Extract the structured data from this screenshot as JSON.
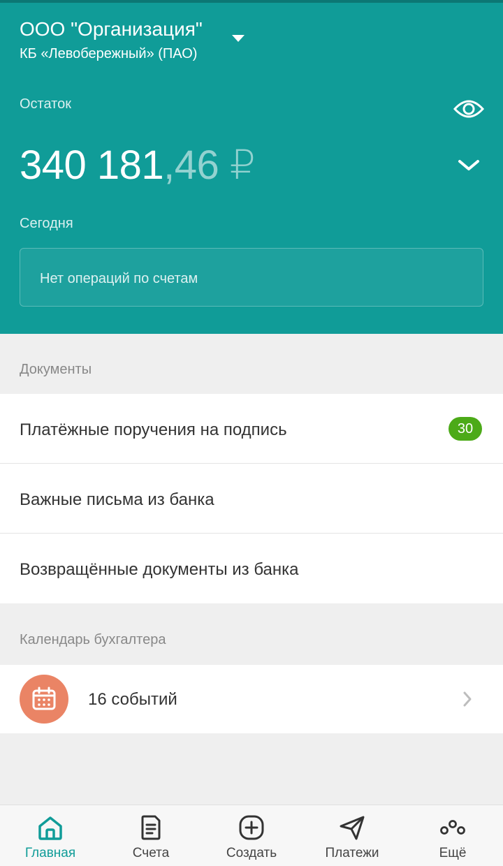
{
  "header": {
    "org_name": "ООО \"Организация\"",
    "bank_name": "КБ «Левобережный» (ПАО)",
    "balance_label": "Остаток",
    "balance_int": "340 181",
    "balance_frac": ",46 ₽",
    "today_label": "Сегодня",
    "no_operations": "Нет операций по счетам"
  },
  "documents": {
    "section_title": "Документы",
    "items": [
      {
        "label": "Платёжные поручения на подпись",
        "badge": "30"
      },
      {
        "label": "Важные письма из банка"
      },
      {
        "label": "Возвращённые документы из банка"
      }
    ]
  },
  "calendar": {
    "section_title": "Календарь бухгалтера",
    "events_label": "16 событий"
  },
  "nav": {
    "items": [
      {
        "label": "Главная",
        "icon": "home-icon"
      },
      {
        "label": "Счета",
        "icon": "document-icon"
      },
      {
        "label": "Создать",
        "icon": "plus-circle-icon"
      },
      {
        "label": "Платежи",
        "icon": "send-icon"
      },
      {
        "label": "Ещё",
        "icon": "more-icon"
      }
    ]
  },
  "colors": {
    "brand": "#109c98",
    "badge": "#4caa18",
    "calendar_icon_bg": "#ea8465"
  }
}
